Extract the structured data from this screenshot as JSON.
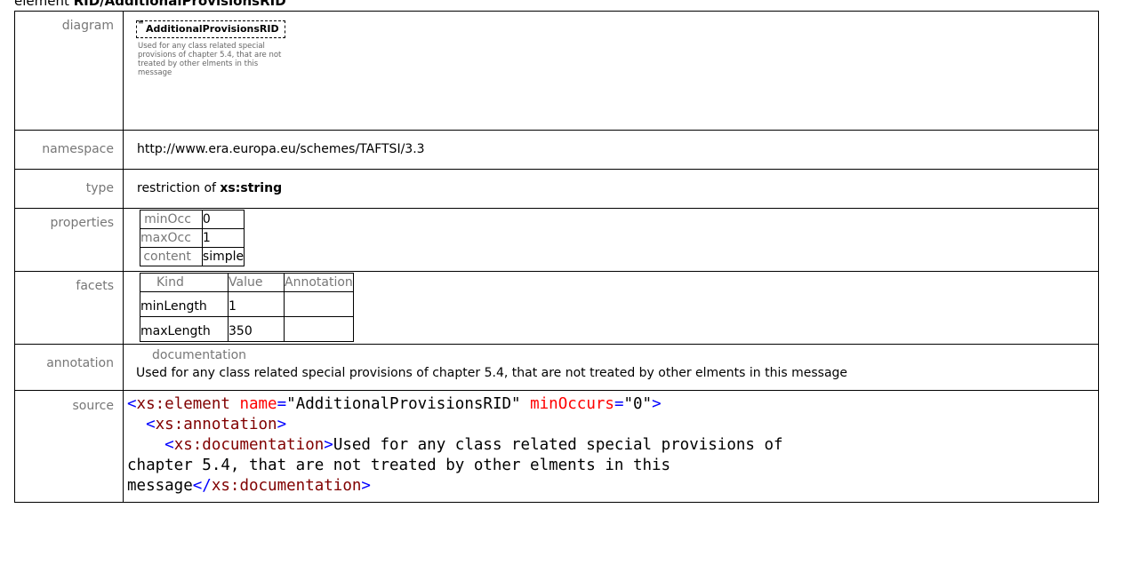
{
  "heading": {
    "prefix": "element ",
    "name": "RID/AdditionalProvisionsRID"
  },
  "rows": {
    "diagram": {
      "label": "diagram",
      "box_title": "AdditionalProvisionsRID",
      "doc_text": "Used for any class related special provisions of chapter 5.4, that are not treated by other elments in this message"
    },
    "namespace": {
      "label": "namespace",
      "value": "http://www.era.europa.eu/schemes/TAFTSI/3.3"
    },
    "type": {
      "label": "type",
      "prefix": "restriction of ",
      "base": "xs:string"
    },
    "properties": {
      "label": "properties",
      "items": [
        {
          "key": "minOcc",
          "value": "0"
        },
        {
          "key": "maxOcc",
          "value": "1"
        },
        {
          "key": "content",
          "value": "simple"
        }
      ]
    },
    "facets": {
      "label": "facets",
      "headers": [
        "Kind",
        "Value",
        "Annotation"
      ],
      "items": [
        {
          "kind": "minLength",
          "value": "1",
          "annotation": ""
        },
        {
          "kind": "maxLength",
          "value": "350",
          "annotation": ""
        }
      ]
    },
    "annotation": {
      "label": "annotation",
      "header": "documentation",
      "text": "Used for any class related special provisions of chapter 5.4, that are not treated by other elments in this message"
    },
    "source": {
      "label": "source",
      "open_tag": "xs:element",
      "attr1_name": "name",
      "attr1_value": "\"AdditionalProvisionsRID\"",
      "attr2_name": "minOccurs",
      "attr2_value": "\"0\"",
      "annotation_tag": "xs:annotation",
      "documentation_tag": "xs:documentation",
      "doc_line1": "Used for any class related special provisions of",
      "doc_line2": "chapter 5.4, that are not treated by other elments in this",
      "doc_line3": "message",
      "close_doc_tag": "xs:documentation"
    }
  }
}
